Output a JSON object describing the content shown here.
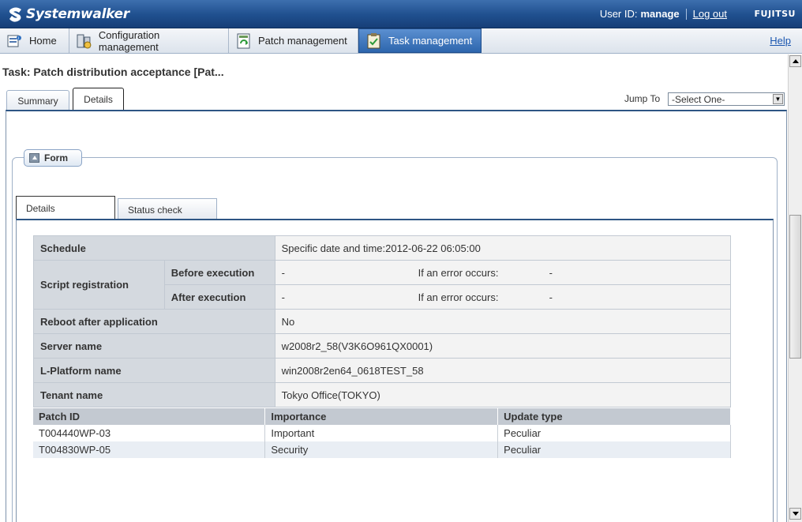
{
  "header": {
    "product_name": "Systemwalker",
    "user_id_label": "User ID:",
    "user_id_value": "manage",
    "logout_label": "Log out",
    "brand": "FUJITSU"
  },
  "nav": {
    "tabs": [
      {
        "label": "Home",
        "icon": "home-icon"
      },
      {
        "label": "Configuration management",
        "icon": "configuration-icon"
      },
      {
        "label": "Patch management",
        "icon": "patch-icon"
      },
      {
        "label": "Task management",
        "icon": "task-icon",
        "active": true
      }
    ],
    "help_label": "Help"
  },
  "page": {
    "title": "Task: Patch distribution acceptance [Pat...",
    "tabs": [
      {
        "label": "Summary"
      },
      {
        "label": "Details",
        "active": true
      }
    ],
    "jump_to_label": "Jump To",
    "jump_to_value": "-Select One-"
  },
  "form": {
    "legend": "Form",
    "tabs": [
      {
        "label": "Details",
        "active": true
      },
      {
        "label": "Status check"
      }
    ],
    "details": {
      "schedule_label": "Schedule",
      "schedule_value": "Specific date and time:2012-06-22 06:05:00",
      "script_registration_label": "Script registration",
      "before_execution_label": "Before execution",
      "before_execution_value": "-",
      "before_error_label": "If an error occurs:",
      "before_error_value": "-",
      "after_execution_label": "After execution",
      "after_execution_value": "-",
      "after_error_label": "If an error occurs:",
      "after_error_value": "-",
      "reboot_label": "Reboot after application",
      "reboot_value": "No",
      "server_name_label": "Server name",
      "server_name_value": "w2008r2_58(V3K6O961QX0001)",
      "lplatform_label": "L-Platform name",
      "lplatform_value": "win2008r2en64_0618TEST_58",
      "tenant_label": "Tenant name",
      "tenant_value": "Tokyo Office(TOKYO)"
    },
    "patches": {
      "columns": [
        "Patch ID",
        "Importance",
        "Update type"
      ],
      "rows": [
        [
          "T004440WP-03",
          "Important",
          "Peculiar"
        ],
        [
          "T004830WP-05",
          "Security",
          "Peculiar"
        ]
      ]
    }
  },
  "colors": {
    "banner": "#1f4f8e",
    "active_nav": "#2d66ad",
    "label_cell": "#d4d9df",
    "value_cell": "#f3f3f3"
  }
}
